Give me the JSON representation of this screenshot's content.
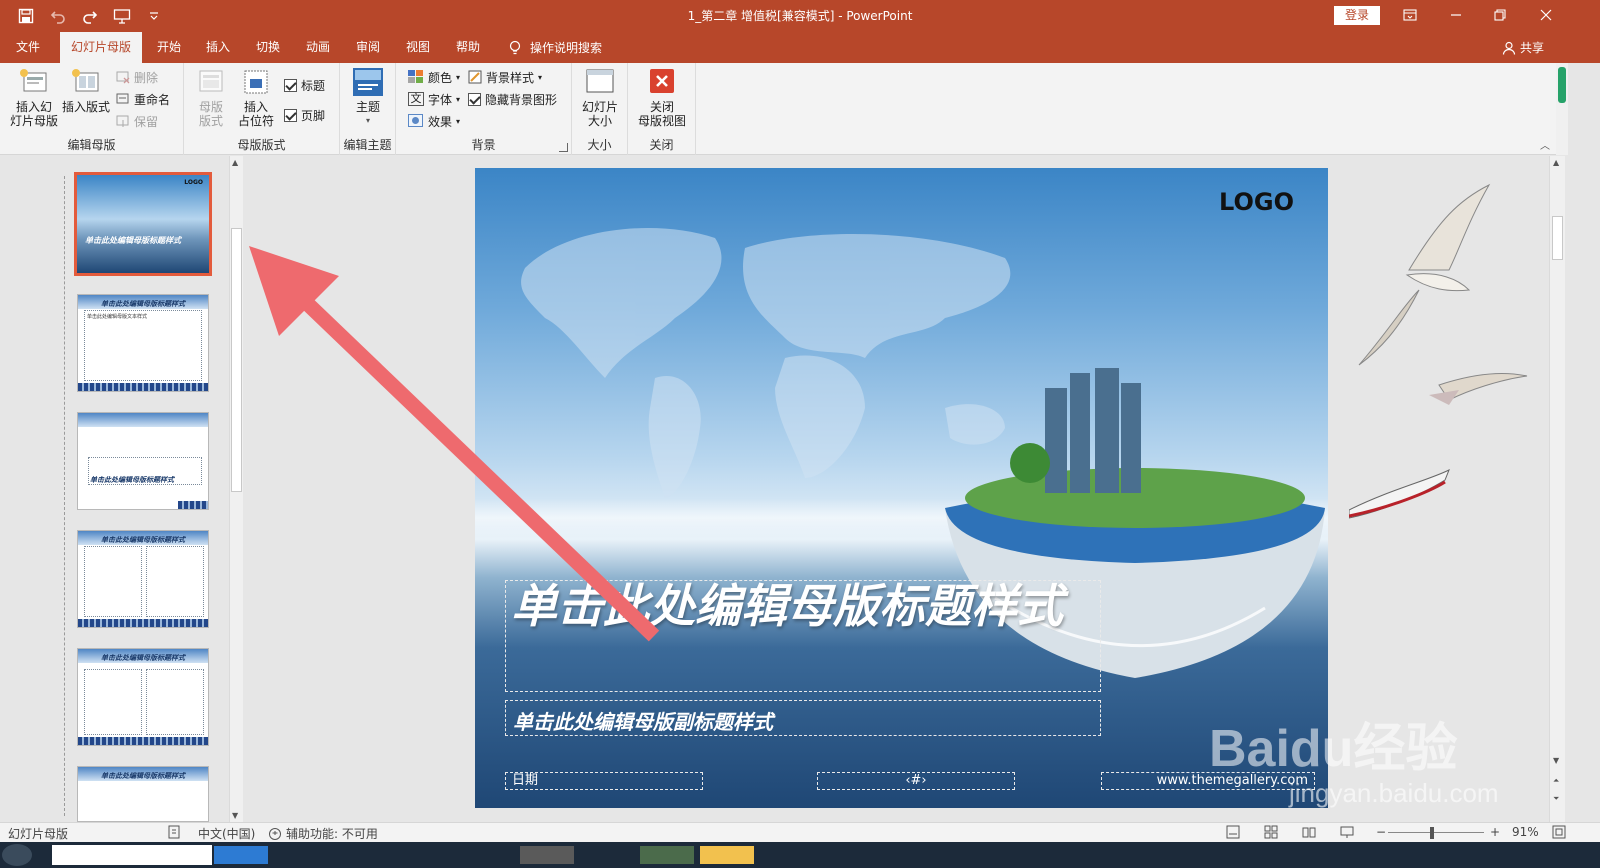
{
  "window": {
    "title": "1_第二章 增值税[兼容模式] - PowerPoint",
    "login_label": "登录"
  },
  "tabs": [
    {
      "label": "文件"
    },
    {
      "label": "幻灯片母版",
      "active": true
    },
    {
      "label": "开始"
    },
    {
      "label": "插入"
    },
    {
      "label": "切换"
    },
    {
      "label": "动画"
    },
    {
      "label": "审阅"
    },
    {
      "label": "视图"
    },
    {
      "label": "帮助"
    }
  ],
  "tell_me": "操作说明搜索",
  "share_label": "共享",
  "ribbon": {
    "edit_master": {
      "label": "编辑母版",
      "insert_master": "插入幻\n灯片母版",
      "insert_layout": "插入版式",
      "delete": "删除",
      "rename": "重命名",
      "preserve": "保留"
    },
    "master_layout": {
      "label": "母版版式",
      "master_layout_btn": "母版\n版式",
      "insert_placeholder": "插入\n占位符",
      "title_check": "标题",
      "footer_check": "页脚"
    },
    "edit_theme": {
      "label": "编辑主题",
      "themes": "主题"
    },
    "background": {
      "label": "背景",
      "colors": "颜色",
      "fonts": "字体",
      "effects": "效果",
      "bg_styles": "背景样式",
      "hide_bg": "隐藏背景图形"
    },
    "size": {
      "label": "大小",
      "slide_size": "幻灯片\n大小"
    },
    "close": {
      "label": "关闭",
      "close_master": "关闭\n母版视图"
    }
  },
  "thumbnails": {
    "title_text": "单击此处编辑母版标题样式",
    "content_text": "单击此处编辑母版文本样式"
  },
  "slide": {
    "logo": "LOGO",
    "title": "单击此处编辑母版标题样式",
    "subtitle": "单击此处编辑母版副标题样式",
    "date": "日期",
    "number": "‹#›",
    "url": "www.themegallery.com"
  },
  "statusbar": {
    "view": "幻灯片母版",
    "language": "中文(中国)",
    "accessibility": "辅助功能: 不可用",
    "zoom": "91%"
  },
  "watermark": {
    "brand": "Baidu经验",
    "site": "jingyan.baidu.com"
  },
  "colors": {
    "accent": "#b7472a",
    "selected_thumb": "#e35b3c",
    "annotation_arrow": "#ee6a6e"
  }
}
